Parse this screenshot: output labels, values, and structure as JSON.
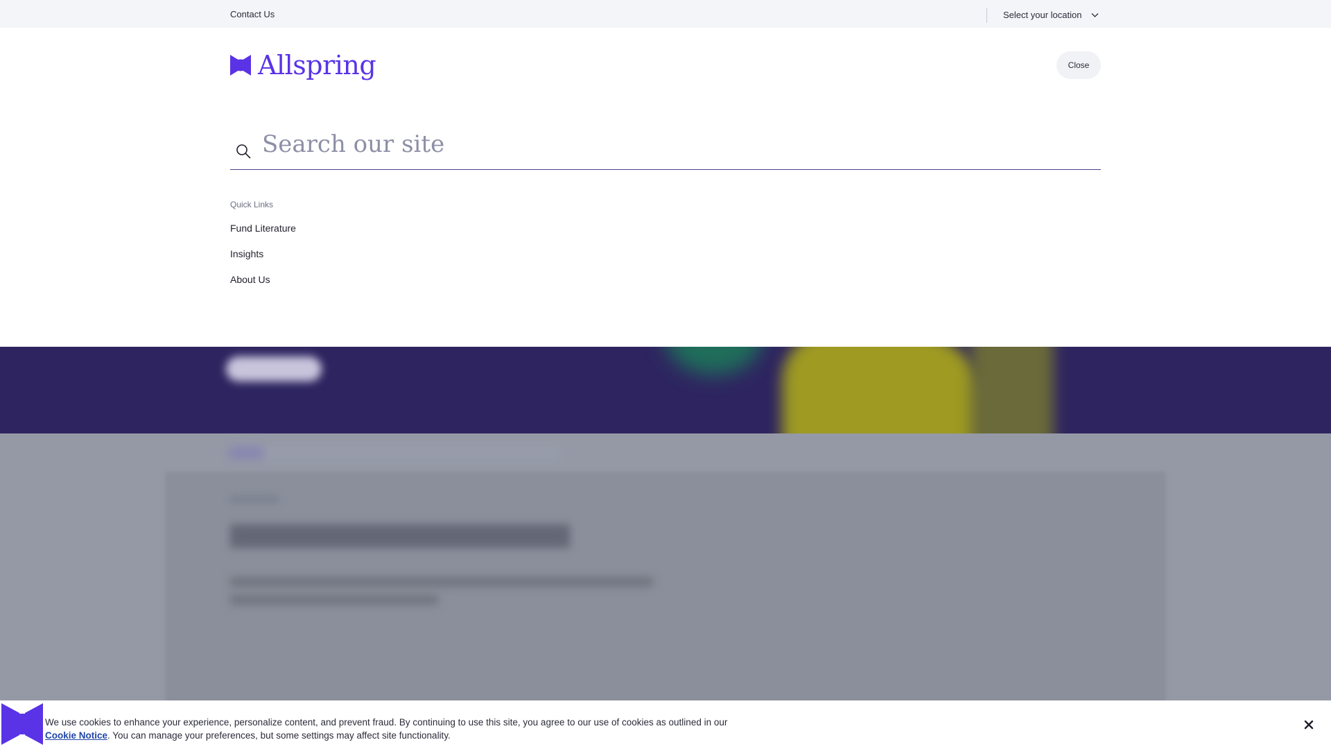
{
  "utility_bar": {
    "contact_label": "Contact Us",
    "location_label": "Select your location",
    "chevron_icon": "chevron-down-icon"
  },
  "header": {
    "logo_text": "Allspring",
    "close_label": "Close",
    "brand_color": "#5a33e6"
  },
  "search": {
    "placeholder": "Search our site",
    "value": "",
    "icon": "search-icon"
  },
  "quick_links": {
    "title": "Quick Links",
    "items": [
      {
        "label": "Fund Literature"
      },
      {
        "label": "Insights"
      },
      {
        "label": "About Us"
      }
    ]
  },
  "cookie_banner": {
    "text_before": "We use cookies to enhance your experience, personalize content, and prevent fraud. By continuing to use this site, you agree to our use of cookies as outlined in our ",
    "link_label": "Cookie Notice",
    "text_after": ". You can manage your preferences, but some settings may affect site functionality.",
    "close_icon": "close-icon"
  },
  "colors": {
    "hero_background": "#2e2560",
    "overlay": "#9599a6",
    "link": "#2046a8"
  }
}
